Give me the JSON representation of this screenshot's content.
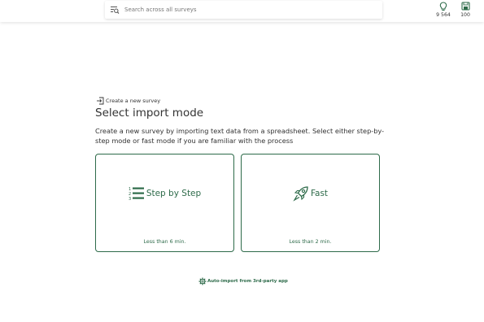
{
  "search": {
    "placeholder": "Search across all surveys"
  },
  "stats": [
    {
      "icon": "lightbulb-icon",
      "value": "9 564"
    },
    {
      "icon": "save-icon",
      "value": "100"
    }
  ],
  "breadcrumb": {
    "label": "Create a new survey"
  },
  "page": {
    "title": "Select import mode",
    "description": "Create a new survey by importing text data from a spreadsheet. Select either step-by-step mode or fast mode if you are familiar with the process"
  },
  "modes": [
    {
      "icon": "numbered-list-icon",
      "label": "Step by Step",
      "time": "Less than 6 min."
    },
    {
      "icon": "rocket-icon",
      "label": "Fast",
      "time": "Less than 2 min."
    }
  ],
  "auto_import": {
    "label": "Auto-import from 3rd-party app"
  },
  "colors": {
    "accent": "#2e6b4a",
    "text": "#333333"
  }
}
